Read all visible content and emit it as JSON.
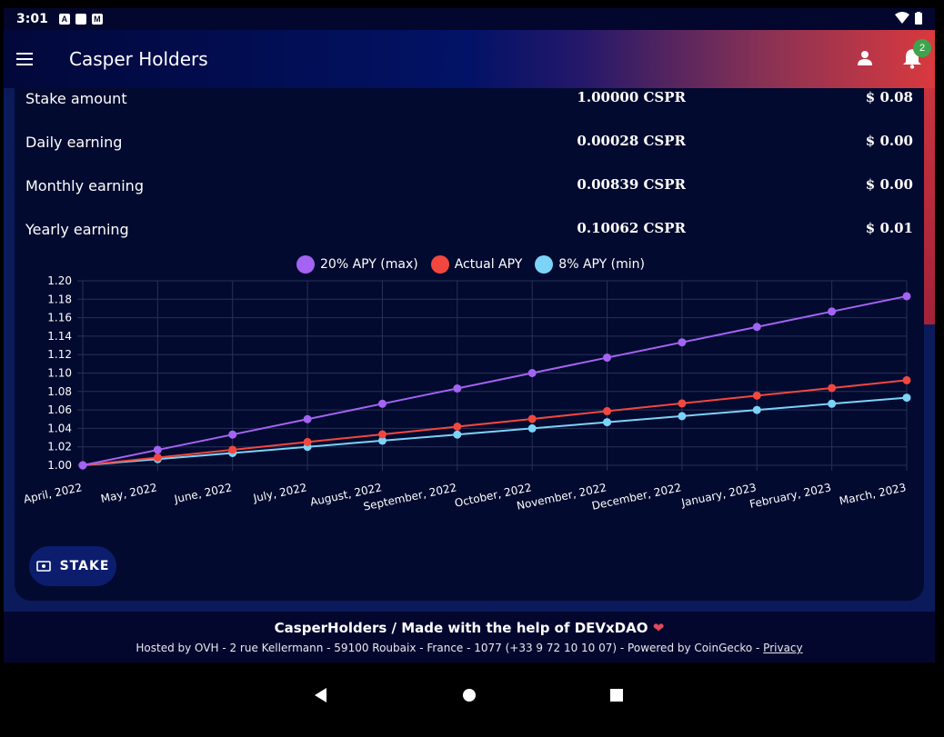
{
  "status_bar": {
    "time": "3:01",
    "icons": [
      "app-a-icon",
      "sd-card-icon",
      "gmail-icon"
    ],
    "right_icons": [
      "wifi-icon",
      "battery-icon"
    ]
  },
  "app_bar": {
    "title": "Casper Holders",
    "notification_count": "2"
  },
  "earnings": [
    {
      "label": "Stake amount",
      "cspr": "1.00000 CSPR",
      "usd": "$ 0.08"
    },
    {
      "label": "Daily earning",
      "cspr": "0.00028 CSPR",
      "usd": "$ 0.00"
    },
    {
      "label": "Monthly earning",
      "cspr": "0.00839 CSPR",
      "usd": "$ 0.00"
    },
    {
      "label": "Yearly earning",
      "cspr": "0.10062 CSPR",
      "usd": "$ 0.01"
    }
  ],
  "chart_data": {
    "type": "line",
    "title": "",
    "xlabel": "",
    "ylabel": "",
    "categories": [
      "April, 2022",
      "May, 2022",
      "June, 2022",
      "July, 2022",
      "August, 2022",
      "September, 2022",
      "October, 2022",
      "November, 2022",
      "December, 2022",
      "January, 2023",
      "February, 2023",
      "March, 2023"
    ],
    "ylim": [
      1.0,
      1.2
    ],
    "yticks": [
      "1.00",
      "1.02",
      "1.04",
      "1.06",
      "1.08",
      "1.10",
      "1.12",
      "1.14",
      "1.16",
      "1.18",
      "1.20"
    ],
    "grid": true,
    "legend_position": "top",
    "series": [
      {
        "name": "20% APY (max)",
        "color": "#a463f2",
        "values": [
          1.0,
          1.0167,
          1.0333,
          1.05,
          1.0667,
          1.0833,
          1.1,
          1.1167,
          1.1333,
          1.15,
          1.1667,
          1.1833
        ]
      },
      {
        "name": "Actual APY",
        "color": "#f2473f",
        "values": [
          1.0,
          1.0084,
          1.0168,
          1.0252,
          1.0335,
          1.0419,
          1.0503,
          1.0587,
          1.0671,
          1.0755,
          1.0838,
          1.0922
        ]
      },
      {
        "name": "8% APY (min)",
        "color": "#7bd3f7",
        "values": [
          1.0,
          1.0067,
          1.0133,
          1.02,
          1.0267,
          1.0333,
          1.04,
          1.0467,
          1.0533,
          1.06,
          1.0667,
          1.0733
        ]
      }
    ]
  },
  "stake_button": {
    "label": "STAKE"
  },
  "footer": {
    "line1": "CasperHolders / Made with the help of DEVxDAO",
    "line2": "Hosted by OVH - 2 rue Kellermann - 59100 Roubaix - France - 1077 (+33 9 72 10 10 07) - Powered by CoinGecko - ",
    "privacy": "Privacy"
  }
}
